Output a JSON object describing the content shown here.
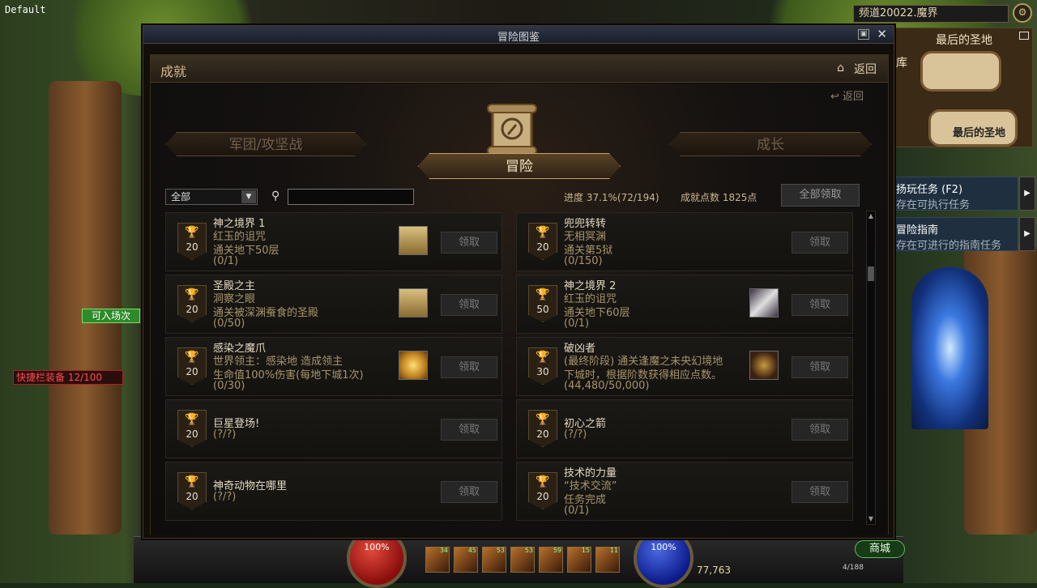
{
  "hud": {
    "default_label": "Default",
    "channel": "频道20022.魔界",
    "minimap_title": "最后的圣地",
    "minimap_label": "最后的圣地",
    "minimap_side": "库",
    "quest1_title": "扬玩任务 (F2)",
    "quest1_sub": "存在可执行任务",
    "quest2_title": "冒险指南",
    "quest2_sub": "存在可进行的指南任务",
    "enter_label": "可入场次",
    "quickbar_label": "快捷栏装备  12/100",
    "hp_text": "100%",
    "mp_text": "100%",
    "gold": "77,763",
    "shop": "商城",
    "exp": "4/188",
    "skill_counts": [
      "34",
      "45",
      "53",
      "53",
      "59",
      "15",
      "11"
    ]
  },
  "window": {
    "title": "冒险图鉴",
    "section_title": "成就",
    "back_label": "返回",
    "back2_label": "返回",
    "tabs": {
      "guild": "军团/攻坚战",
      "adventure": "冒险",
      "growth": "成长"
    },
    "filter_value": "全部",
    "search_value": "",
    "progress_label": "进度  37.1%(72/194)",
    "points_label": "成就点数 1825点",
    "claim_all": "全部领取"
  },
  "achievements": {
    "left": [
      {
        "name": "神之境界 1",
        "lines": [
          "红玉的诅咒",
          "通关地下50层",
          "(0/1)"
        ],
        "points": "20",
        "gold": false,
        "reward_icon": "map-icon",
        "claim": "领取"
      },
      {
        "name": "圣殿之主",
        "lines": [
          "洞察之眼",
          "通关被深渊蚕食的圣殿",
          "(0/50)"
        ],
        "points": "20",
        "gold": false,
        "reward_icon": "map-icon",
        "claim": "领取"
      },
      {
        "name": "感染之魔爪",
        "lines": [
          "世界领主：感染地         造成领主",
          "生命值100%伤害(每地下城1次)",
          "(0/30)"
        ],
        "points": "20",
        "gold": false,
        "reward_icon": "star-icon",
        "claim": "领取"
      },
      {
        "name": "巨星登场!",
        "lines": [
          "(?/?)"
        ],
        "points": "20",
        "gold": false,
        "reward_icon": "",
        "claim": "领取"
      },
      {
        "name": "神奇动物在哪里",
        "lines": [
          "(?/?)"
        ],
        "points": "20",
        "gold": false,
        "reward_icon": "",
        "claim": "领取"
      }
    ],
    "right": [
      {
        "name": "兜兜转转",
        "lines": [
          "无相冥渊",
          "通关第5狱",
          "(0/150)"
        ],
        "points": "20",
        "gold": false,
        "reward_icon": "",
        "claim": "领取"
      },
      {
        "name": "神之境界 2",
        "lines": [
          "红玉的诅咒",
          "通关地下60层",
          "(0/1)"
        ],
        "points": "50",
        "gold": true,
        "reward_icon": "scroll-icon",
        "claim": "领取"
      },
      {
        "name": "破凶者",
        "lines": [
          "(最终阶段) 通关逢魔之未央幻境地",
          "下城时，根据阶数获得相应点数。",
          "(44,480/50,000)"
        ],
        "points": "30",
        "gold": false,
        "reward_icon": "emblem-icon",
        "claim": "领取"
      },
      {
        "name": "初心之箭",
        "lines": [
          "(?/?)"
        ],
        "points": "20",
        "gold": false,
        "reward_icon": "",
        "claim": "领取"
      },
      {
        "name": "技术的力量",
        "lines": [
          "“技术交流”",
          "任务完成",
          "(0/1)"
        ],
        "points": "20",
        "gold": false,
        "reward_icon": "",
        "claim": "领取"
      }
    ]
  }
}
